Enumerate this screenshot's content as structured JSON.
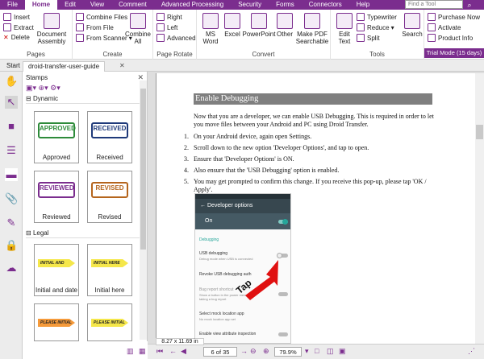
{
  "menubar": {
    "items": [
      "File",
      "Home",
      "Edit",
      "View",
      "Comment",
      "Advanced Processing",
      "Security",
      "Forms",
      "Connectors",
      "Help"
    ],
    "active": "Home",
    "search_placeholder": "Find a Tool"
  },
  "ribbon": {
    "pages": {
      "label": "Pages",
      "insert": "Insert",
      "extract": "Extract",
      "delete": "Delete",
      "doc_assembly_1": "Document",
      "doc_assembly_2": "Assembly"
    },
    "create": {
      "label": "Create",
      "combine_files": "Combine Files",
      "from_file": "From File",
      "from_scanner": "From Scanner",
      "combine_all_1": "Combine",
      "combine_all_2": "All"
    },
    "rotate": {
      "label": "Page Rotate",
      "right": "Right",
      "left": "Left",
      "advanced": "Advanced"
    },
    "convert": {
      "label": "Convert",
      "ms_word_1": "MS",
      "ms_word_2": "Word",
      "excel": "Excel",
      "powerpoint": "PowerPoint",
      "other": "Other",
      "pdf_search_1": "Make PDF",
      "pdf_search_2": "Searchable"
    },
    "tools": {
      "label": "Tools",
      "edit_text_1": "Edit",
      "edit_text_2": "Text",
      "typewriter": "Typewriter",
      "reduce": "Reduce",
      "split": "Split",
      "search": "Search"
    },
    "purchase": {
      "purchase_now": "Purchase Now",
      "activate": "Activate",
      "product_info": "Product Info"
    },
    "trial": "Trial Mode (15 days)"
  },
  "tabs": {
    "start": "Start",
    "document": "droid-transfer-user-guide"
  },
  "stamps_panel": {
    "title": "Stamps",
    "sections": {
      "dynamic": "Dynamic",
      "legal": "Legal"
    },
    "stamps": [
      {
        "text": "APPROVED",
        "label": "Approved"
      },
      {
        "text": "RECEIVED",
        "label": "Received"
      },
      {
        "text": "REVIEWED",
        "label": "Reviewed"
      },
      {
        "text": "REVISED",
        "label": "Revised"
      },
      {
        "text": "INITIAL AND DATE",
        "label": "Initial and date"
      },
      {
        "text": "INITIAL HERE",
        "label": "Initial here"
      },
      {
        "text": "PLEASE INITIAL AND DATE",
        "label": ""
      },
      {
        "text": "PLEASE INITIAL HERE",
        "label": ""
      }
    ]
  },
  "document": {
    "heading": "Enable Debugging",
    "intro": "Now that you are a developer, we can enable USB Debugging. This is required in order to let you move files between your Android and PC using Droid Transfer.",
    "steps": [
      "On your Android device, again open Settings.",
      "Scroll down to the new option 'Developer Options', and tap to open.",
      "Ensure that 'Developer Options' is ON.",
      "Also ensure that the 'USB Debugging' option is enabled.",
      "You may get prompted to confirm this change. If you receive this pop-up, please tap 'OK / Apply'."
    ],
    "phone": {
      "title": "Developer options",
      "on": "On",
      "section": "Debugging",
      "usb_debugging": "USB debugging",
      "usb_sub": "Debug mode when USB is connected",
      "revoke": "Revoke USB debugging auth",
      "bug_report": "Bug report shortcut",
      "bug_sub": "Show a button in the power menu for taking a bug report",
      "mock": "Select mock location app",
      "mock_sub": "No mock location app set",
      "view_attr": "Enable view attribute inspection",
      "tap": "Tap"
    }
  },
  "statusbar": {
    "page_size": "8.27 x 11.69 in",
    "page": "6 of 35",
    "zoom": "79.9%"
  },
  "colors": {
    "accent": "#7b2d8e",
    "approved": "#2e8b3a",
    "received": "#1f3a7a",
    "reviewed": "#7b2d8e",
    "revised": "#b5651d",
    "arrow": "#e01010"
  }
}
